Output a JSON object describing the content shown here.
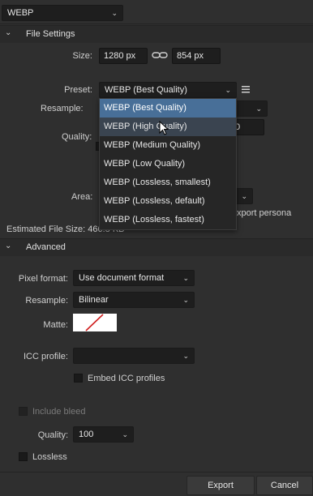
{
  "format": {
    "value": "WEBP"
  },
  "file_settings": {
    "title": "File Settings",
    "size_label": "Size:",
    "width": "1280 px",
    "height": "854 px",
    "preset_label": "Preset:",
    "preset_value": "WEBP (Best Quality)",
    "resample_label": "Resample:",
    "quality_label": "Quality:",
    "quality_fragment": "0",
    "area_label": "Area:",
    "export_persona_fragment": "xport persona",
    "estimated_size_label": "Estimated File Size:",
    "estimated_size_value": "466.8 KB"
  },
  "preset_menu": {
    "items": [
      "WEBP (Best Quality)",
      "WEBP (High Quality)",
      "WEBP (Medium Quality)",
      "WEBP (Low Quality)",
      "WEBP (Lossless, smallest)",
      "WEBP (Lossless, default)",
      "WEBP (Lossless, fastest)"
    ],
    "selected_index": 0,
    "hover_index": 1
  },
  "advanced": {
    "title": "Advanced",
    "pixel_format_label": "Pixel format:",
    "pixel_format_value": "Use document format",
    "resample_label": "Resample:",
    "resample_value": "Bilinear",
    "matte_label": "Matte:",
    "icc_label": "ICC profile:",
    "icc_value": "",
    "embed_icc_label": "Embed ICC profiles",
    "include_bleed_label": "Include bleed",
    "quality_label": "Quality:",
    "quality_value": "100",
    "lossless_label": "Lossless"
  },
  "buttons": {
    "export": "Export",
    "cancel": "Cancel"
  },
  "colors": {
    "menu_selected": "#486f98",
    "matte_slash": "#d01f1f"
  }
}
